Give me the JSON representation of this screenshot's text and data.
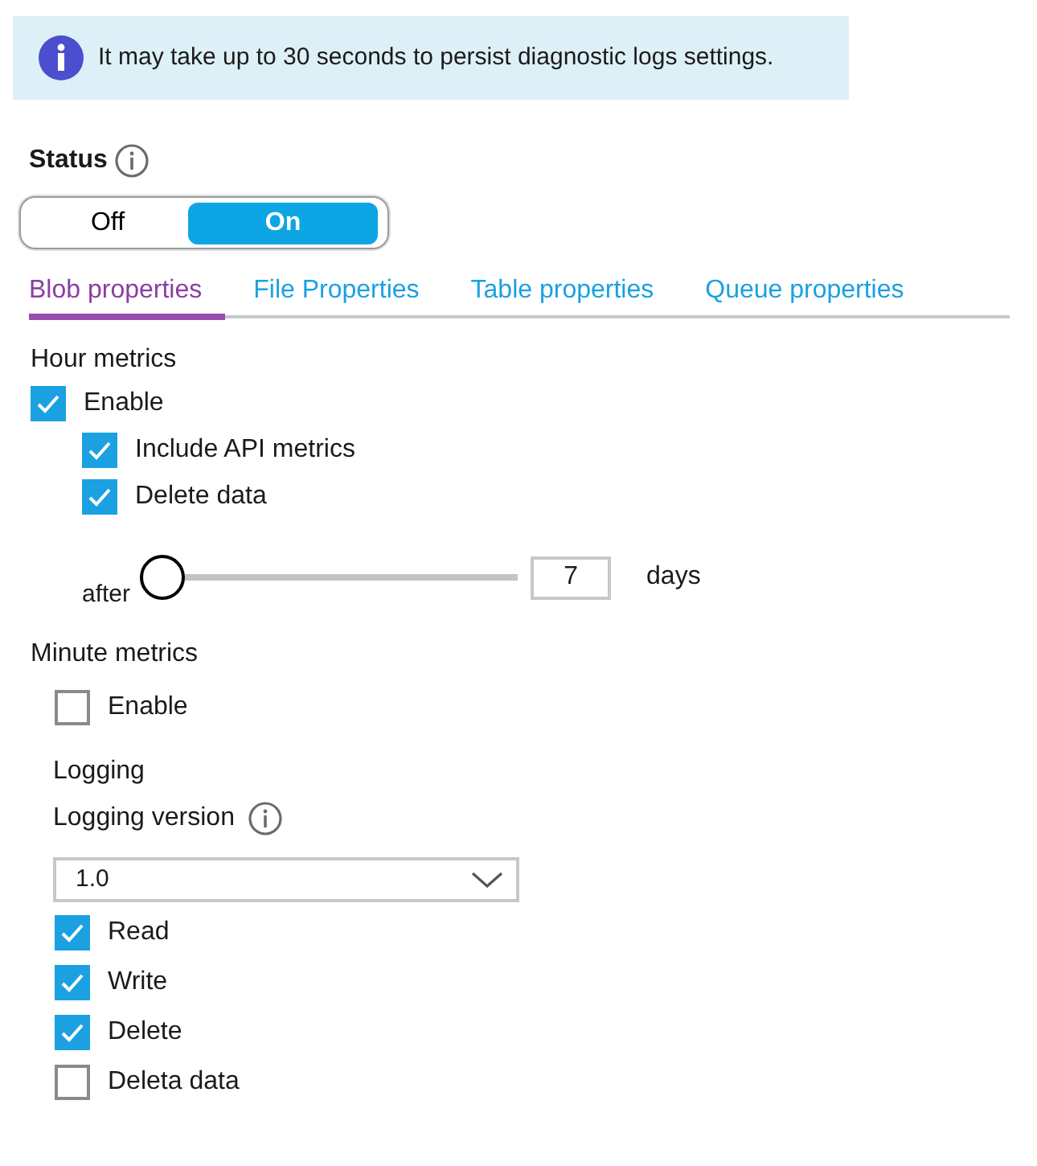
{
  "banner": {
    "text": "It may take up to 30 seconds to persist diagnostic logs settings."
  },
  "status": {
    "label": "Status",
    "options": [
      {
        "label": "Off",
        "selected": false
      },
      {
        "label": "On",
        "selected": true
      }
    ]
  },
  "tabs": [
    {
      "label": "Blob properties",
      "selected": true
    },
    {
      "label": "File Properties",
      "selected": false
    },
    {
      "label": "Table properties",
      "selected": false
    },
    {
      "label": "Queue properties",
      "selected": false
    }
  ],
  "hour_metrics": {
    "title": "Hour metrics",
    "enable": {
      "label": "Enable",
      "checked": true
    },
    "options": [
      {
        "label": "Include API metrics",
        "checked": true
      },
      {
        "label": "Delete data",
        "checked": true
      }
    ],
    "retention": {
      "prefix": "after",
      "level": 0,
      "value": "7",
      "unit": "days"
    }
  },
  "minute_metrics": {
    "title": "Minute metrics",
    "enable": {
      "label": "Enable",
      "checked": false
    }
  },
  "logging": {
    "title": "Logging",
    "version_label": "Logging version",
    "version": "1.0",
    "options": [
      {
        "label": "Read",
        "checked": true
      },
      {
        "label": "Write",
        "checked": true
      },
      {
        "label": "Delete",
        "checked": true
      },
      {
        "label": "Deleta data",
        "checked": false
      }
    ]
  }
}
